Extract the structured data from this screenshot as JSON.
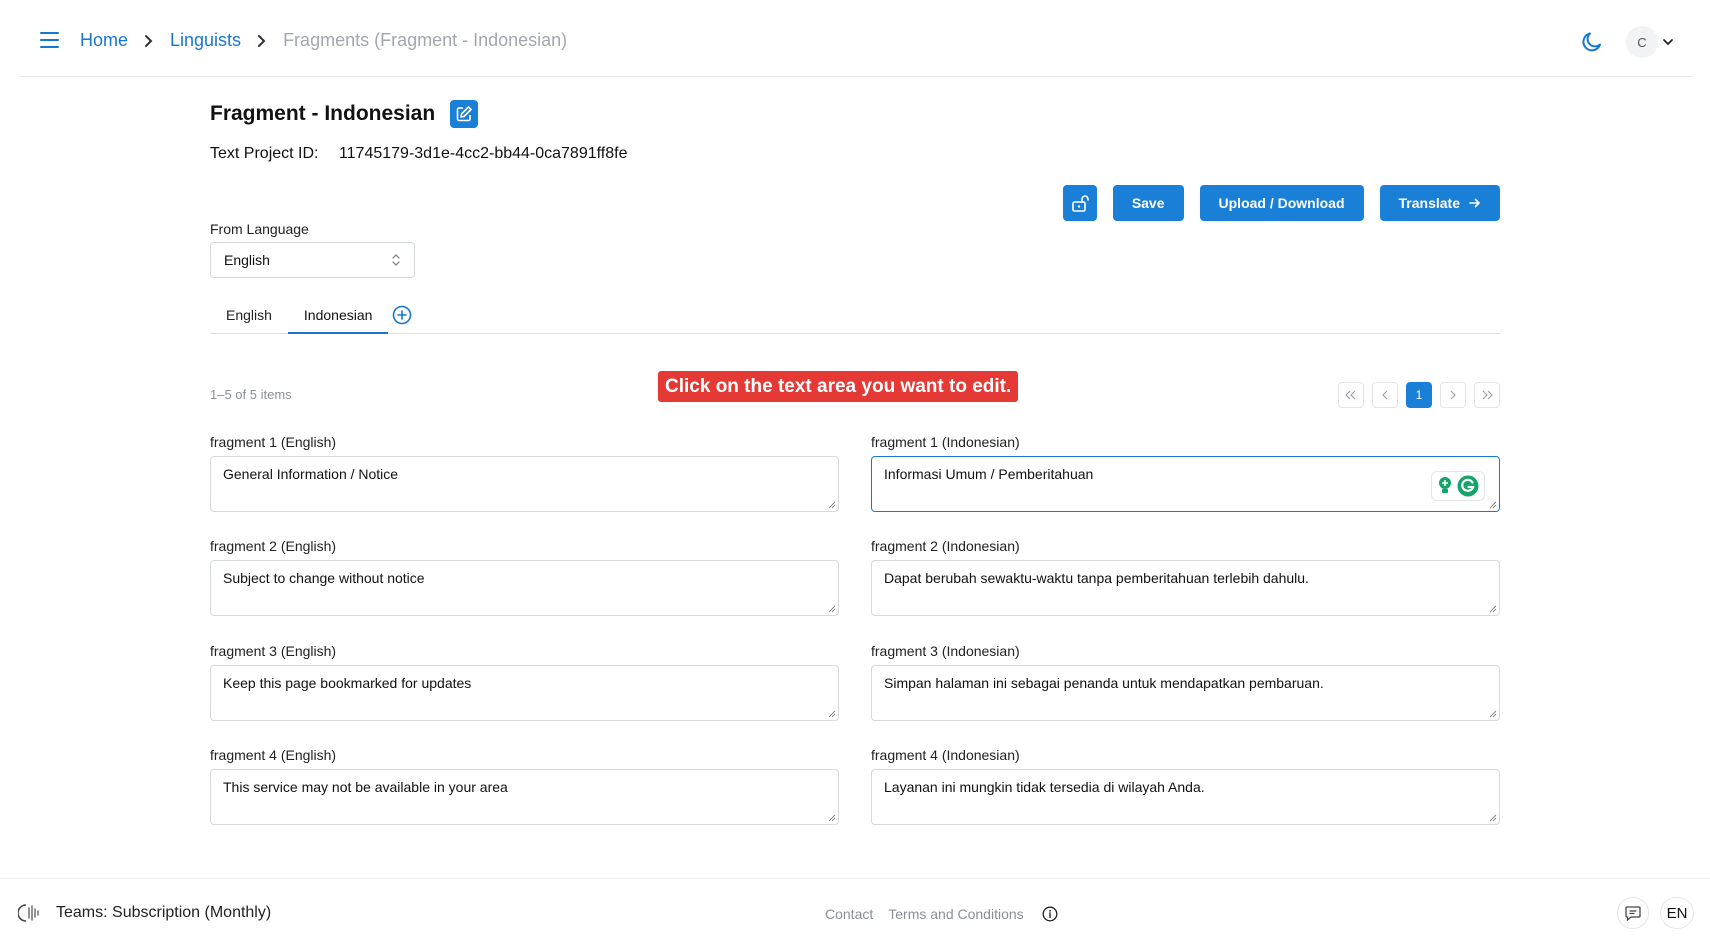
{
  "breadcrumb": {
    "home": "Home",
    "linguists": "Linguists",
    "current": "Fragments (Fragment - Indonesian)"
  },
  "header": {
    "avatar_initial": "C"
  },
  "page": {
    "title": "Fragment - Indonesian",
    "project_id_label": "Text Project ID:",
    "project_id_value": "11745179-3d1e-4cc2-bb44-0ca7891ff8fe"
  },
  "actions": {
    "save": "Save",
    "upload_download": "Upload / Download",
    "translate": "Translate"
  },
  "from_language": {
    "label": "From Language",
    "value": "English"
  },
  "tabs": [
    {
      "label": "English",
      "active": false
    },
    {
      "label": "Indonesian",
      "active": true
    }
  ],
  "list": {
    "count": "1–5 of 5 items",
    "hint": "Click on the text area you want to edit.",
    "current_page": "1"
  },
  "fragments": [
    {
      "src_label": "fragment 1 (English)",
      "src_text": "General Information / Notice",
      "tgt_label": "fragment 1 (Indonesian)",
      "tgt_text": "Informasi Umum / Pemberitahuan"
    },
    {
      "src_label": "fragment 2 (English)",
      "src_text": "Subject to change without notice",
      "tgt_label": "fragment 2 (Indonesian)",
      "tgt_text": "Dapat berubah sewaktu-waktu tanpa pemberitahuan terlebih dahulu."
    },
    {
      "src_label": "fragment 3 (English)",
      "src_text": "Keep this page bookmarked for updates",
      "tgt_label": "fragment 3 (Indonesian)",
      "tgt_text": "Simpan halaman ini sebagai penanda untuk mendapatkan pembaruan."
    },
    {
      "src_label": "fragment 4 (English)",
      "src_text": "This service may not be available in your area",
      "tgt_label": "fragment 4 (Indonesian)",
      "tgt_text": "Layanan ini mungkin tidak tersedia di wilayah Anda."
    }
  ],
  "footer": {
    "plan": "Teams: Subscription (Monthly)",
    "contact": "Contact",
    "terms": "Terms and Conditions",
    "language": "EN"
  },
  "colors": {
    "accent": "#1a7fd6",
    "hint_bg": "#e53935",
    "grammarly": "#15a36a"
  }
}
